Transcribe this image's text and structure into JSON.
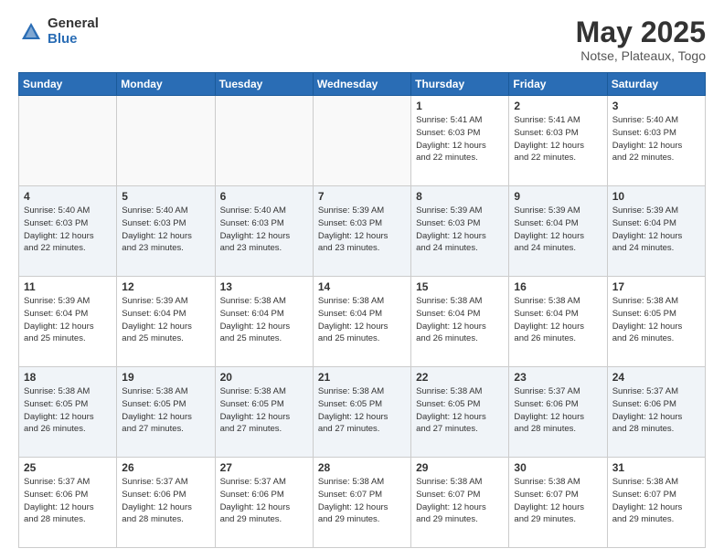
{
  "logo": {
    "general": "General",
    "blue": "Blue"
  },
  "title": "May 2025",
  "location": "Notse, Plateaux, Togo",
  "days_of_week": [
    "Sunday",
    "Monday",
    "Tuesday",
    "Wednesday",
    "Thursday",
    "Friday",
    "Saturday"
  ],
  "weeks": [
    [
      {
        "day": "",
        "info": ""
      },
      {
        "day": "",
        "info": ""
      },
      {
        "day": "",
        "info": ""
      },
      {
        "day": "",
        "info": ""
      },
      {
        "day": "1",
        "info": "Sunrise: 5:41 AM\nSunset: 6:03 PM\nDaylight: 12 hours\nand 22 minutes."
      },
      {
        "day": "2",
        "info": "Sunrise: 5:41 AM\nSunset: 6:03 PM\nDaylight: 12 hours\nand 22 minutes."
      },
      {
        "day": "3",
        "info": "Sunrise: 5:40 AM\nSunset: 6:03 PM\nDaylight: 12 hours\nand 22 minutes."
      }
    ],
    [
      {
        "day": "4",
        "info": "Sunrise: 5:40 AM\nSunset: 6:03 PM\nDaylight: 12 hours\nand 22 minutes."
      },
      {
        "day": "5",
        "info": "Sunrise: 5:40 AM\nSunset: 6:03 PM\nDaylight: 12 hours\nand 23 minutes."
      },
      {
        "day": "6",
        "info": "Sunrise: 5:40 AM\nSunset: 6:03 PM\nDaylight: 12 hours\nand 23 minutes."
      },
      {
        "day": "7",
        "info": "Sunrise: 5:39 AM\nSunset: 6:03 PM\nDaylight: 12 hours\nand 23 minutes."
      },
      {
        "day": "8",
        "info": "Sunrise: 5:39 AM\nSunset: 6:03 PM\nDaylight: 12 hours\nand 24 minutes."
      },
      {
        "day": "9",
        "info": "Sunrise: 5:39 AM\nSunset: 6:04 PM\nDaylight: 12 hours\nand 24 minutes."
      },
      {
        "day": "10",
        "info": "Sunrise: 5:39 AM\nSunset: 6:04 PM\nDaylight: 12 hours\nand 24 minutes."
      }
    ],
    [
      {
        "day": "11",
        "info": "Sunrise: 5:39 AM\nSunset: 6:04 PM\nDaylight: 12 hours\nand 25 minutes."
      },
      {
        "day": "12",
        "info": "Sunrise: 5:39 AM\nSunset: 6:04 PM\nDaylight: 12 hours\nand 25 minutes."
      },
      {
        "day": "13",
        "info": "Sunrise: 5:38 AM\nSunset: 6:04 PM\nDaylight: 12 hours\nand 25 minutes."
      },
      {
        "day": "14",
        "info": "Sunrise: 5:38 AM\nSunset: 6:04 PM\nDaylight: 12 hours\nand 25 minutes."
      },
      {
        "day": "15",
        "info": "Sunrise: 5:38 AM\nSunset: 6:04 PM\nDaylight: 12 hours\nand 26 minutes."
      },
      {
        "day": "16",
        "info": "Sunrise: 5:38 AM\nSunset: 6:04 PM\nDaylight: 12 hours\nand 26 minutes."
      },
      {
        "day": "17",
        "info": "Sunrise: 5:38 AM\nSunset: 6:05 PM\nDaylight: 12 hours\nand 26 minutes."
      }
    ],
    [
      {
        "day": "18",
        "info": "Sunrise: 5:38 AM\nSunset: 6:05 PM\nDaylight: 12 hours\nand 26 minutes."
      },
      {
        "day": "19",
        "info": "Sunrise: 5:38 AM\nSunset: 6:05 PM\nDaylight: 12 hours\nand 27 minutes."
      },
      {
        "day": "20",
        "info": "Sunrise: 5:38 AM\nSunset: 6:05 PM\nDaylight: 12 hours\nand 27 minutes."
      },
      {
        "day": "21",
        "info": "Sunrise: 5:38 AM\nSunset: 6:05 PM\nDaylight: 12 hours\nand 27 minutes."
      },
      {
        "day": "22",
        "info": "Sunrise: 5:38 AM\nSunset: 6:05 PM\nDaylight: 12 hours\nand 27 minutes."
      },
      {
        "day": "23",
        "info": "Sunrise: 5:37 AM\nSunset: 6:06 PM\nDaylight: 12 hours\nand 28 minutes."
      },
      {
        "day": "24",
        "info": "Sunrise: 5:37 AM\nSunset: 6:06 PM\nDaylight: 12 hours\nand 28 minutes."
      }
    ],
    [
      {
        "day": "25",
        "info": "Sunrise: 5:37 AM\nSunset: 6:06 PM\nDaylight: 12 hours\nand 28 minutes."
      },
      {
        "day": "26",
        "info": "Sunrise: 5:37 AM\nSunset: 6:06 PM\nDaylight: 12 hours\nand 28 minutes."
      },
      {
        "day": "27",
        "info": "Sunrise: 5:37 AM\nSunset: 6:06 PM\nDaylight: 12 hours\nand 29 minutes."
      },
      {
        "day": "28",
        "info": "Sunrise: 5:38 AM\nSunset: 6:07 PM\nDaylight: 12 hours\nand 29 minutes."
      },
      {
        "day": "29",
        "info": "Sunrise: 5:38 AM\nSunset: 6:07 PM\nDaylight: 12 hours\nand 29 minutes."
      },
      {
        "day": "30",
        "info": "Sunrise: 5:38 AM\nSunset: 6:07 PM\nDaylight: 12 hours\nand 29 minutes."
      },
      {
        "day": "31",
        "info": "Sunrise: 5:38 AM\nSunset: 6:07 PM\nDaylight: 12 hours\nand 29 minutes."
      }
    ]
  ]
}
